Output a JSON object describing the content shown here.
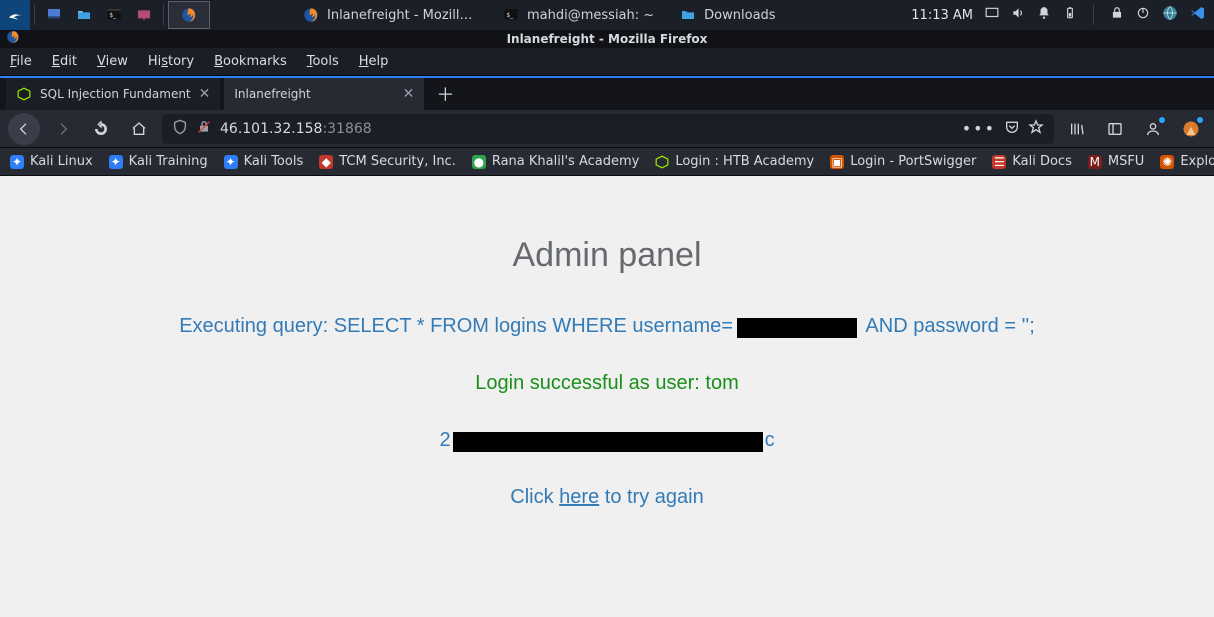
{
  "panel": {
    "clock": "11:13 AM",
    "tasks": [
      {
        "label": "Inlanefreight - Mozilla ...",
        "icon": "firefox"
      },
      {
        "label": "mahdi@messiah: ~",
        "icon": "terminal"
      },
      {
        "label": "Downloads",
        "icon": "folder"
      }
    ]
  },
  "firefox": {
    "window_title": "Inlanefreight - Mozilla Firefox",
    "menus": [
      "File",
      "Edit",
      "View",
      "History",
      "Bookmarks",
      "Tools",
      "Help"
    ],
    "tabs": [
      {
        "title": "SQL Injection Fundament",
        "active": false,
        "favicon": "htb"
      },
      {
        "title": "Inlanefreight",
        "active": true,
        "favicon": "none"
      }
    ],
    "url": {
      "host": "46.101.32.158",
      "port": ":31868"
    },
    "bookmarks": [
      {
        "label": "Kali Linux",
        "cls": "bg-blue"
      },
      {
        "label": "Kali Training",
        "cls": "bg-blue"
      },
      {
        "label": "Kali Tools",
        "cls": "bg-blue"
      },
      {
        "label": "TCM Security, Inc.",
        "cls": "bg-red"
      },
      {
        "label": "Rana Khalil's Academy",
        "cls": "bg-green"
      },
      {
        "label": "Login : HTB Academy",
        "cls": "bg-green"
      },
      {
        "label": "Login - PortSwigger",
        "cls": "bg-orange"
      },
      {
        "label": "Kali Docs",
        "cls": "bg-red"
      },
      {
        "label": "MSFU",
        "cls": "bg-dred"
      },
      {
        "label": "Exploit",
        "cls": "bg-orange"
      }
    ]
  },
  "page": {
    "heading": "Admin panel",
    "query_prefix": "Executing query: SELECT * FROM logins WHERE username=",
    "query_suffix": " AND password = '';",
    "login_msg": "Login successful as user: tom",
    "flag_prefix": "2",
    "flag_suffix": "c",
    "try_again_prefix": "Click ",
    "try_again_link": "here",
    "try_again_suffix": " to try again"
  }
}
